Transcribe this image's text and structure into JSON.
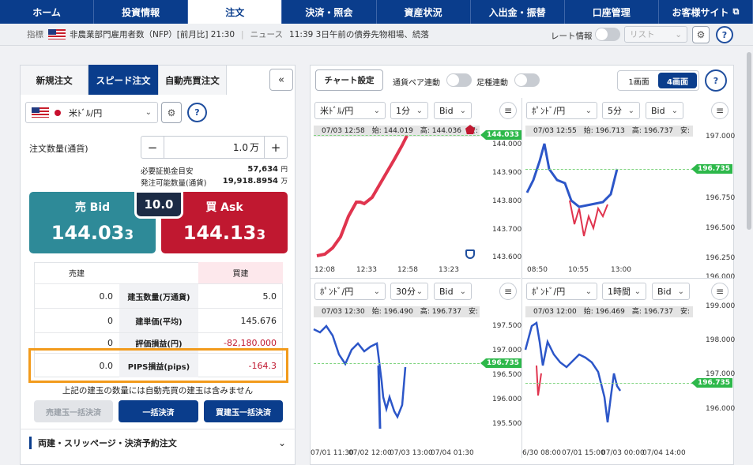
{
  "nav": [
    "ホーム",
    "投資情報",
    "注文",
    "決済・照会",
    "資産状況",
    "入出金・振替",
    "口座管理",
    "お客様サイト"
  ],
  "info": {
    "label": "指標",
    "indicator": "非農業部門雇用者数（NFP）[前月比] 21:30",
    "news_label": "ニュース",
    "news": "11:39 3日午前の債券先物相場、続落",
    "rate_label": "レート情報",
    "list_label": "リスト"
  },
  "order": {
    "tabs": [
      "新規注文",
      "スピード注文",
      "自動売買注文"
    ],
    "pair": "米ﾄﾞﾙ/円",
    "qty_label": "注文数量(通貨)",
    "qty_value": "1.0",
    "qty_unit": "万",
    "margin_label": "必要証拠金目安",
    "margin_value": "57,634",
    "margin_unit": "円",
    "avail_label": "発注可能数量(通貨)",
    "avail_value": "19,918.8954",
    "avail_unit": "万",
    "spread": "10.0",
    "bid_label": "売 Bid",
    "bid_main": "144.03",
    "bid_small": "3",
    "ask_label": "買 Ask",
    "ask_main": "144.13",
    "ask_small": "3",
    "sell_header": "売建",
    "buy_header": "買建",
    "rows": [
      {
        "label": "建玉数量(万通貨)",
        "sell": "0.0",
        "buy": "5.0"
      },
      {
        "label": "建単価(平均)",
        "sell": "0",
        "buy": "145.676"
      },
      {
        "label": "評価損益(円)",
        "sell": "0",
        "buy": "-82,180.000"
      },
      {
        "label": "PIPS損益(pips)",
        "sell": "0.0",
        "buy": "-164.3"
      }
    ],
    "note": "上記の建玉の数量には自動売買の建玉は含みません",
    "btn_sell_all": "売建玉一括決済",
    "btn_all": "一括決済",
    "btn_buy_all": "買建玉一括決済",
    "footer": "両建・スリッページ・決済予約注文"
  },
  "charts_toolbar": {
    "settings": "チャート設定",
    "pair_link": "通貨ペア連動",
    "type_link": "足種連動",
    "view1": "1画面",
    "view4": "4画面"
  },
  "charts": [
    {
      "pair": "米ﾄﾞﾙ/円",
      "tf": "1分",
      "side": "Bid",
      "header": "07/03 12:58　始: 144.019　高: 144.036　安:",
      "current": "144.033",
      "yticks": [
        "144.000",
        "143.900",
        "143.800",
        "143.700",
        "143.600"
      ],
      "xticks": [
        "12:08",
        "12:33",
        "12:58",
        "13:23"
      ]
    },
    {
      "pair": "ﾎﾟﾝﾄﾞ/円",
      "tf": "5分",
      "side": "Bid",
      "header": "07/03 12:55　始: 196.713　高: 196.737　安:",
      "current": "196.735",
      "yticks": [
        "197.000",
        "196.750",
        "196.500",
        "196.250",
        "196.000"
      ],
      "xticks": [
        "08:50",
        "10:55",
        "13:00"
      ]
    },
    {
      "pair": "ﾎﾟﾝﾄﾞ/円",
      "tf": "30分",
      "side": "Bid",
      "header": "07/03 12:30　始: 196.490　高: 196.737　安:",
      "current": "196.735",
      "yticks": [
        "197.500",
        "197.000",
        "196.500",
        "196.000",
        "195.500"
      ],
      "xticks": [
        "07/01 11:30",
        "07/02 12:00",
        "07/03 13:00",
        "07/04 01:30"
      ]
    },
    {
      "pair": "ﾎﾟﾝﾄﾞ/円",
      "tf": "1時間",
      "side": "Bid",
      "header": "07/03 12:00　始: 196.469　高: 196.737　安:",
      "current": "196.735",
      "yticks": [
        "199.000",
        "198.000",
        "197.000",
        "196.000"
      ],
      "xticks": [
        "6/30 08:00",
        "07/01 15:00",
        "07/03 00:00",
        "07/04 14:00"
      ]
    }
  ]
}
